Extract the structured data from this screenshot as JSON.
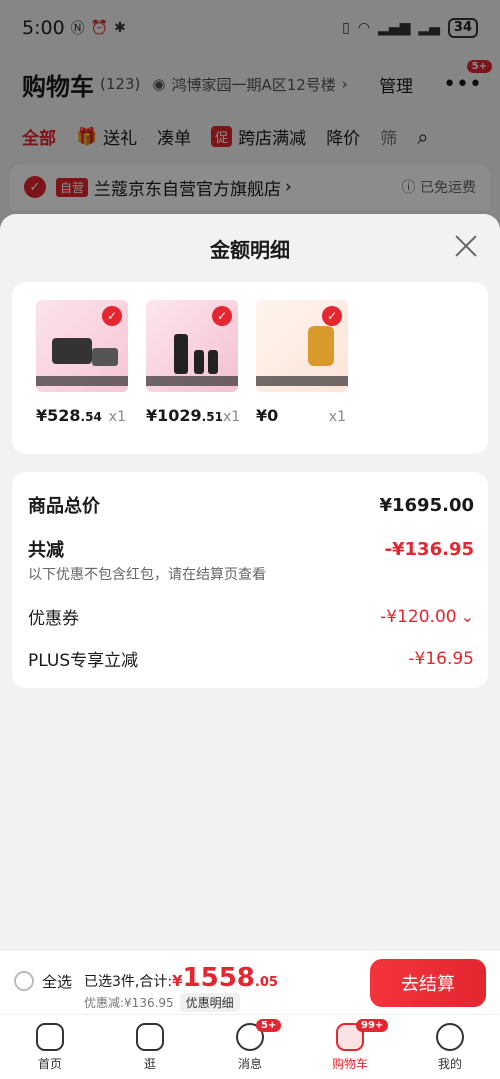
{
  "status": {
    "time": "5:00",
    "battery": "34"
  },
  "header": {
    "title": "购物车",
    "count": "(123)",
    "address": "鸿博家园一期A区12号楼",
    "manage": "管理",
    "badge": "5+"
  },
  "tabs": [
    {
      "label": "全部"
    },
    {
      "label": "送礼"
    },
    {
      "label": "凑单"
    },
    {
      "label": "跨店满减",
      "tag": "促"
    },
    {
      "label": "降价"
    },
    {
      "label": "筛"
    }
  ],
  "store": {
    "self": "自营",
    "name": "兰蔻京东自营官方旗舰店",
    "ship": "已免运费"
  },
  "sheet": {
    "title": "金额明细"
  },
  "products": [
    {
      "price_main": "¥528",
      "price_dec": ".54",
      "qty": "x1"
    },
    {
      "price_main": "¥1029",
      "price_dec": ".51",
      "qty": "x1"
    },
    {
      "price_main": "¥0",
      "price_dec": "",
      "qty": "x1"
    }
  ],
  "summary": {
    "total_label": "商品总价",
    "total_value": "¥1695.00",
    "reduce_label": "共减",
    "reduce_value": "-¥136.95",
    "note": "以下优惠不包含红包，请在结算页查看",
    "coupon_label": "优惠券",
    "coupon_value": "-¥120.00",
    "plus_label": "PLUS专享立减",
    "plus_value": "-¥16.95"
  },
  "footer": {
    "select_all": "全选",
    "selected_text": "已选3件,合计:",
    "currency": "¥",
    "total_main": "1558",
    "total_dec": ".05",
    "discount_text": "优惠减:¥136.95",
    "detail_btn": "优惠明细",
    "checkout": "去结算"
  },
  "nav": [
    {
      "label": "首页"
    },
    {
      "label": "逛"
    },
    {
      "label": "消息",
      "badge": "5+"
    },
    {
      "label": "购物车",
      "badge": "99+"
    },
    {
      "label": "我的"
    }
  ],
  "colors": {
    "accent": "#e3262f"
  }
}
